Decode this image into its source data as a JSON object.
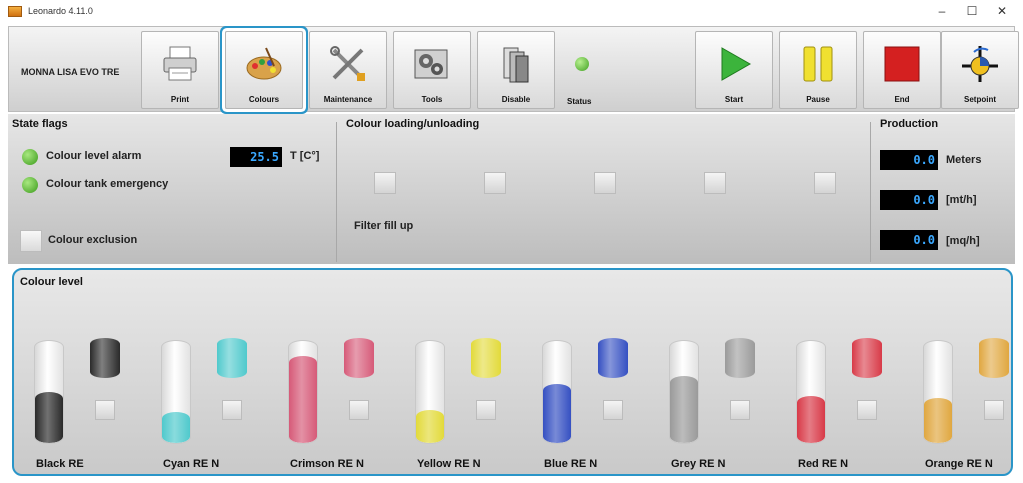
{
  "window": {
    "title": "Leonardo 4.11.0",
    "minimize": "–",
    "maximize": "☐",
    "close": "✕"
  },
  "toolbar": {
    "machine_name": "MONNA LISA EVO TRE",
    "buttons": [
      {
        "label": "Print",
        "icon": "printer-icon"
      },
      {
        "label": "Colours",
        "icon": "palette-icon",
        "selected": true
      },
      {
        "label": "Maintenance",
        "icon": "tools-icon"
      },
      {
        "label": "Tools",
        "icon": "gears-icon"
      },
      {
        "label": "Disable",
        "icon": "disable-icon"
      },
      {
        "label": "Status",
        "icon": "status-led",
        "color": "#4cb82a"
      },
      {
        "label": "Start",
        "icon": "play-icon"
      },
      {
        "label": "Pause",
        "icon": "pause-icon"
      },
      {
        "label": "End",
        "icon": "stop-icon"
      },
      {
        "label": "Setpoint",
        "icon": "setpoint-icon"
      }
    ]
  },
  "state_flags": {
    "title": "State flags",
    "colour_level_alarm": "Colour level alarm",
    "temperature_value": "25.5",
    "temperature_unit": "T [C°]",
    "colour_tank_emergency": "Colour tank emergency",
    "colour_exclusion": "Colour exclusion"
  },
  "loading": {
    "title": "Colour loading/unloading",
    "filter_fill_up": "Filter fill up"
  },
  "production": {
    "title": "Production",
    "meters_value": "0.0",
    "meters_unit": "Meters",
    "speed_value": "0.0",
    "speed_unit": "[mt/h]",
    "area_value": "0.0",
    "area_unit": "[mq/h]"
  },
  "colour_level": {
    "title": "Colour level",
    "tanks": [
      {
        "name": "Black RE",
        "color": "#2a2a2a",
        "level": 0.5
      },
      {
        "name": "Cyan RE N",
        "color": "#4fc9cc",
        "level": 0.3
      },
      {
        "name": "Crimson RE N",
        "color": "#d65a78",
        "level": 0.85
      },
      {
        "name": "Yellow RE N",
        "color": "#e2da3a",
        "level": 0.32
      },
      {
        "name": "Blue RE N",
        "color": "#3550c2",
        "level": 0.58
      },
      {
        "name": "Grey RE N",
        "color": "#9a9a9a",
        "level": 0.66
      },
      {
        "name": "Red RE N",
        "color": "#d83a48",
        "level": 0.46
      },
      {
        "name": "Orange RE N",
        "color": "#e0a740",
        "level": 0.44
      }
    ]
  }
}
